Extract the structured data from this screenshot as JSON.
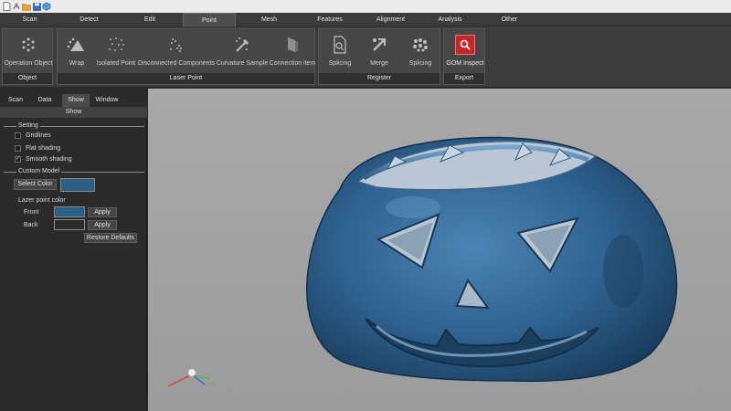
{
  "colors": {
    "model": "#2c5f86",
    "front_swatch": "#2c5f86",
    "back_swatch": "#2b2b2b",
    "gom_button": "#c62828"
  },
  "quick_access": [
    "new-file-icon",
    "import-icon",
    "open-folder-icon",
    "save-icon",
    "cube-icon"
  ],
  "menu": {
    "tabs": [
      "Scan",
      "Detect",
      "Edit",
      "Point",
      "Mesh",
      "Features",
      "Alignment",
      "Analysis",
      "Other"
    ],
    "active": "Point"
  },
  "ribbon": {
    "groups": [
      {
        "label": "Object",
        "buttons": [
          {
            "label": "Operation Object",
            "icon": "dots-circle-icon"
          }
        ]
      },
      {
        "label": "Laser Point",
        "buttons": [
          {
            "label": "Wrap",
            "icon": "wrap-icon"
          },
          {
            "label": "Isolated Point",
            "icon": "isolated-point-icon"
          },
          {
            "label": "Disconnected Components",
            "icon": "disconnected-components-icon"
          },
          {
            "label": "Curvature Sample",
            "icon": "curvature-sample-icon"
          },
          {
            "label": "Connection item",
            "icon": "connection-item-icon"
          }
        ]
      },
      {
        "label": "Register",
        "buttons": [
          {
            "label": "Splicing",
            "icon": "splicing-doc-icon"
          },
          {
            "label": "Merge",
            "icon": "merge-icon"
          },
          {
            "label": "Splicing",
            "icon": "splicing-dots-icon"
          }
        ]
      },
      {
        "label": "Export",
        "buttons": [
          {
            "label": "GOM Inspect",
            "icon": "gom-search-icon"
          }
        ]
      }
    ]
  },
  "panel": {
    "tabs": [
      "Scan",
      "Data",
      "Show",
      "Window"
    ],
    "active_tab": "Show",
    "header": "Show",
    "setting": {
      "title": "Setting",
      "options": [
        {
          "label": "Gridlines",
          "checked": false
        },
        {
          "label": "Flat shading",
          "checked": false
        },
        {
          "label": "Smooth shading",
          "checked": true
        }
      ]
    },
    "custom_model": {
      "title": "Custom Model",
      "select_color": "Select Color",
      "lazer_title": "Lazer point color",
      "front_label": "Front",
      "back_label": "Back",
      "apply": "Apply",
      "restore": "Restore Defaults"
    }
  },
  "axes": {
    "y_label": "Y"
  }
}
